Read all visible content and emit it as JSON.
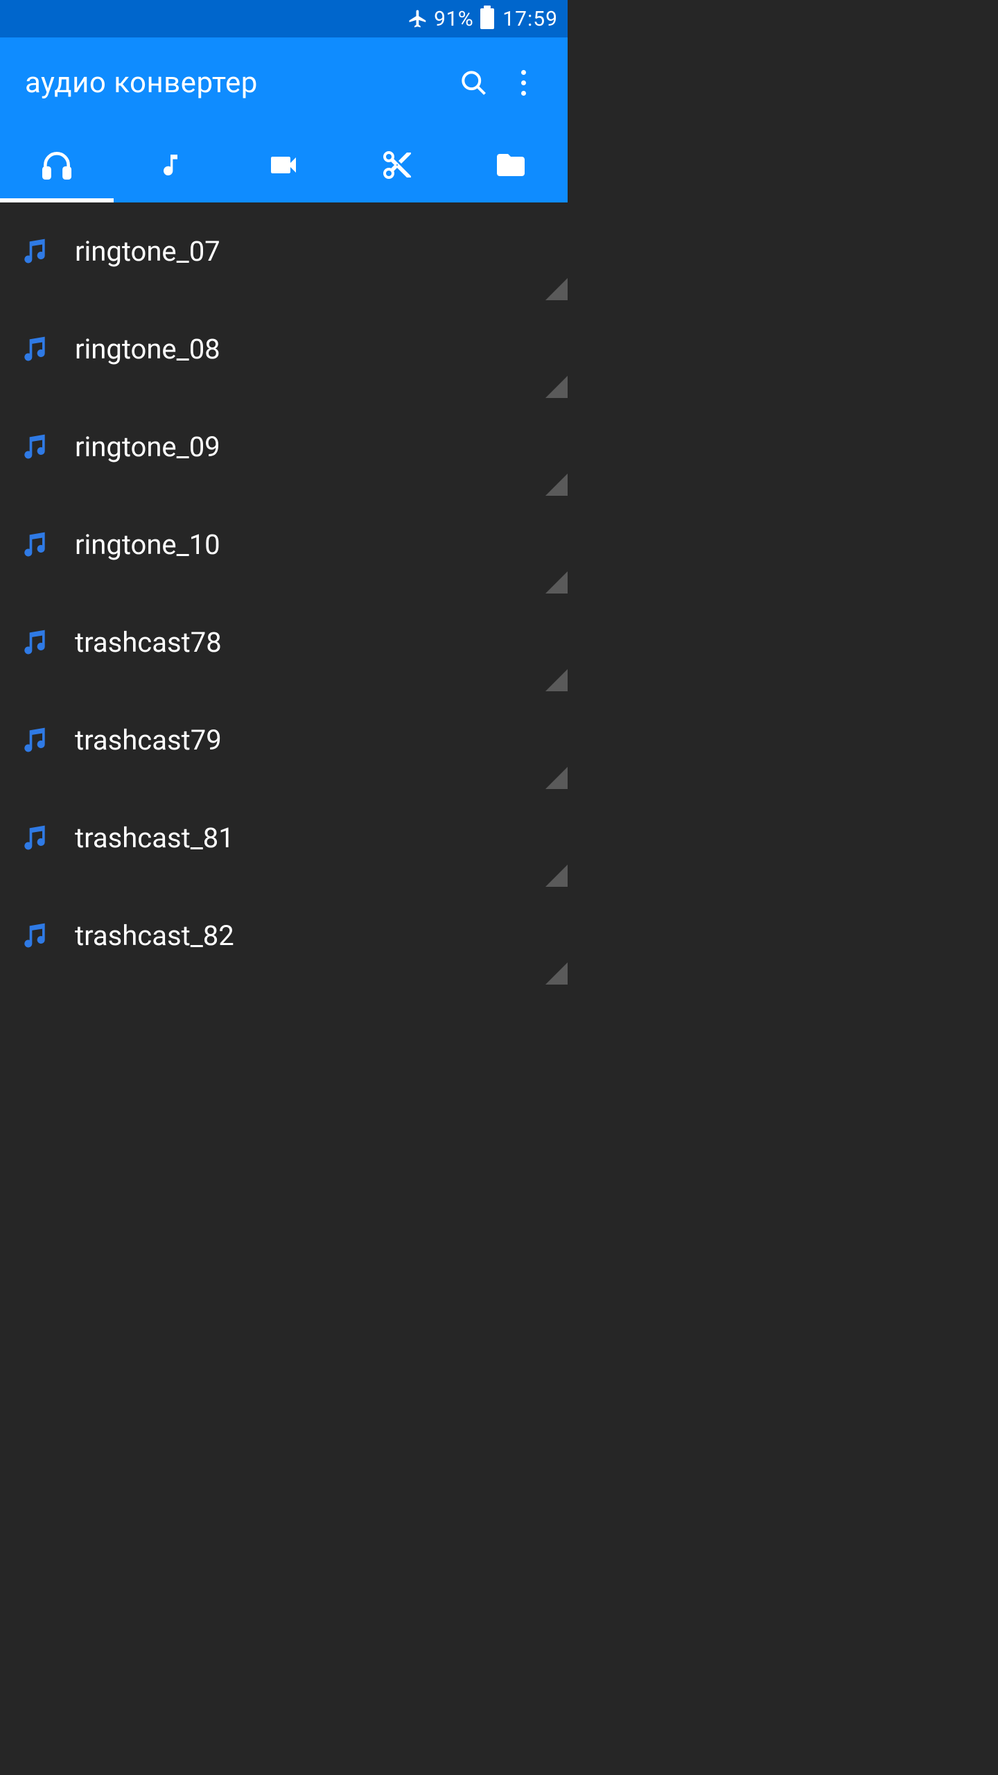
{
  "status": {
    "airplane_icon": "airplane",
    "battery_pct": "91%",
    "time": "17:59"
  },
  "header": {
    "title": "аудио конвертер"
  },
  "tabs": [
    {
      "id": "headphones",
      "active": true
    },
    {
      "id": "music-note",
      "active": false
    },
    {
      "id": "video",
      "active": false
    },
    {
      "id": "cut",
      "active": false
    },
    {
      "id": "folder",
      "active": false
    }
  ],
  "files": [
    {
      "name": "ringtone_07"
    },
    {
      "name": "ringtone_08"
    },
    {
      "name": "ringtone_09"
    },
    {
      "name": "ringtone_10"
    },
    {
      "name": "trashcast78"
    },
    {
      "name": "trashcast79"
    },
    {
      "name": "trashcast_81"
    },
    {
      "name": "trashcast_82"
    }
  ],
  "colors": {
    "status_bg": "#0066cc",
    "app_bar_bg": "#0f8cff",
    "list_bg": "#262626",
    "accent": "#2f7ae5"
  }
}
